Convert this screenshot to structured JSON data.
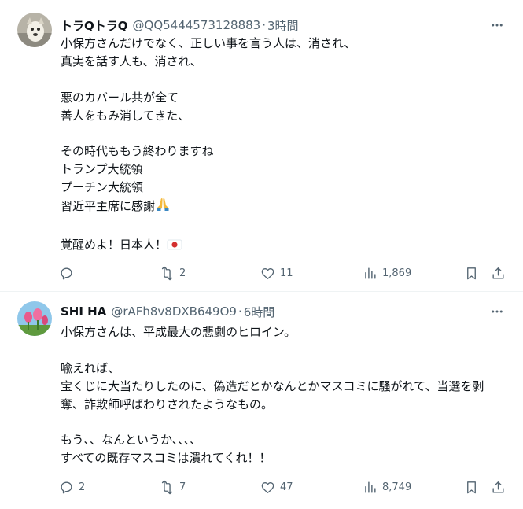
{
  "tweets": [
    {
      "author_name": "トラQトラQ",
      "handle": "@QQ5444573128883",
      "separator": "·",
      "time": "3時間",
      "lines": [
        "小保方さんだけでなく、正しい事を言う人は、消され、",
        "真実を話す人も、消され、",
        "",
        "悪のカバール共が全て",
        "善人をもみ消してきた、",
        "",
        "その時代ももう終わりますね",
        "トランプ大統領",
        "プーチン大統領",
        "習近平主席に感謝",
        "",
        "覚醒めよ！日本人！"
      ],
      "reply_count": "",
      "retweet_count": "2",
      "like_count": "11",
      "view_count": "1,869"
    },
    {
      "author_name": "SHI HA",
      "handle": "@rAFh8v8DXB649O9",
      "separator": "·",
      "time": "6時間",
      "lines": [
        "小保方さんは、平成最大の悲劇のヒロイン。",
        "",
        "喩えれば、",
        "宝くじに大当たりしたのに、偽造だとかなんとかマスコミに騒がれて、当選を剥奪、詐欺師呼ばわりされたようなもの。",
        "",
        "もう、、なんというか、、、、",
        "すべての既存マスコミは潰れてくれ！！"
      ],
      "reply_count": "2",
      "retweet_count": "7",
      "like_count": "47",
      "view_count": "8,749"
    }
  ],
  "icons": {
    "more": "more-icon",
    "reply": "reply-icon",
    "retweet": "retweet-icon",
    "like": "like-icon",
    "views": "views-icon",
    "bookmark": "bookmark-icon",
    "share": "share-icon",
    "pray_emoji": "folded-hands-emoji",
    "flag_emoji": "japan-flag-emoji"
  },
  "colors": {
    "text": "#0f1419",
    "secondary": "#536471",
    "divider": "#eff3f4"
  }
}
